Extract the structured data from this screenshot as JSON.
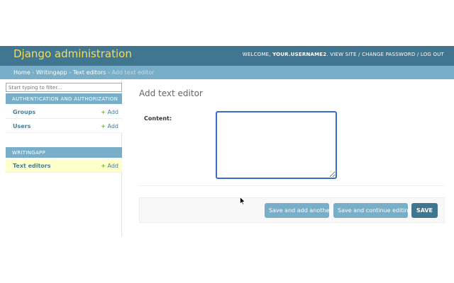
{
  "header": {
    "site_name": "Django administration",
    "welcome": "WELCOME, ",
    "username": "YOUR.USERNAME2",
    "links": [
      "VIEW SITE",
      "CHANGE PASSWORD",
      "LOG OUT"
    ],
    "separator": " / "
  },
  "breadcrumbs": {
    "items": [
      "Home",
      "Writingapp",
      "Text editors"
    ],
    "current": "Add text editor",
    "separator": " › "
  },
  "sidebar": {
    "filter_placeholder": "Start typing to filter...",
    "modules": [
      {
        "caption": "AUTHENTICATION AND AUTHORIZATION",
        "models": [
          {
            "name": "Groups",
            "add": "Add"
          },
          {
            "name": "Users",
            "add": "Add"
          }
        ]
      },
      {
        "caption": "WRITINGAPP",
        "models": [
          {
            "name": "Text editors",
            "add": "Add"
          }
        ]
      }
    ],
    "add_plus": "+"
  },
  "main": {
    "title": "Add text editor",
    "fields": [
      {
        "label": "Content:",
        "value": ""
      }
    ]
  },
  "submit_row": {
    "save_add_another": "Save and add another",
    "save_continue": "Save and continue editing",
    "save": "SAVE"
  },
  "colors": {
    "header_bg": "#417690",
    "site_name": "#f5dd5d",
    "breadcrumbs_bg": "#79aec8",
    "link": "#447e9b",
    "add_plus": "#70bf2b",
    "current_row_bg": "#ffffcc",
    "textarea_focus": "#3a6dc4"
  }
}
